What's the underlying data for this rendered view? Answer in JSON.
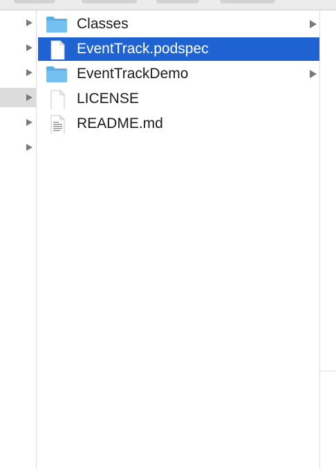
{
  "window": {
    "title": ""
  },
  "left_column": {
    "rows": [
      {
        "expandable": true,
        "active": false
      },
      {
        "expandable": true,
        "active": false
      },
      {
        "expandable": true,
        "active": false
      },
      {
        "expandable": true,
        "active": true
      },
      {
        "expandable": true,
        "active": false
      },
      {
        "expandable": true,
        "active": false
      }
    ]
  },
  "main_column": {
    "items": [
      {
        "name": "Classes",
        "icon": "folder-icon",
        "has_children": true,
        "selected": false
      },
      {
        "name": "EventTrack.podspec",
        "icon": "document-icon",
        "has_children": false,
        "selected": true
      },
      {
        "name": "EventTrackDemo",
        "icon": "folder-icon",
        "has_children": true,
        "selected": false
      },
      {
        "name": "LICENSE",
        "icon": "document-icon",
        "has_children": false,
        "selected": false
      },
      {
        "name": "README.md",
        "icon": "text-document-icon",
        "has_children": false,
        "selected": false
      }
    ]
  },
  "colors": {
    "selection": "#1f63d3",
    "folder": "#6cb7ea",
    "chevron": "#7a7a7a"
  }
}
